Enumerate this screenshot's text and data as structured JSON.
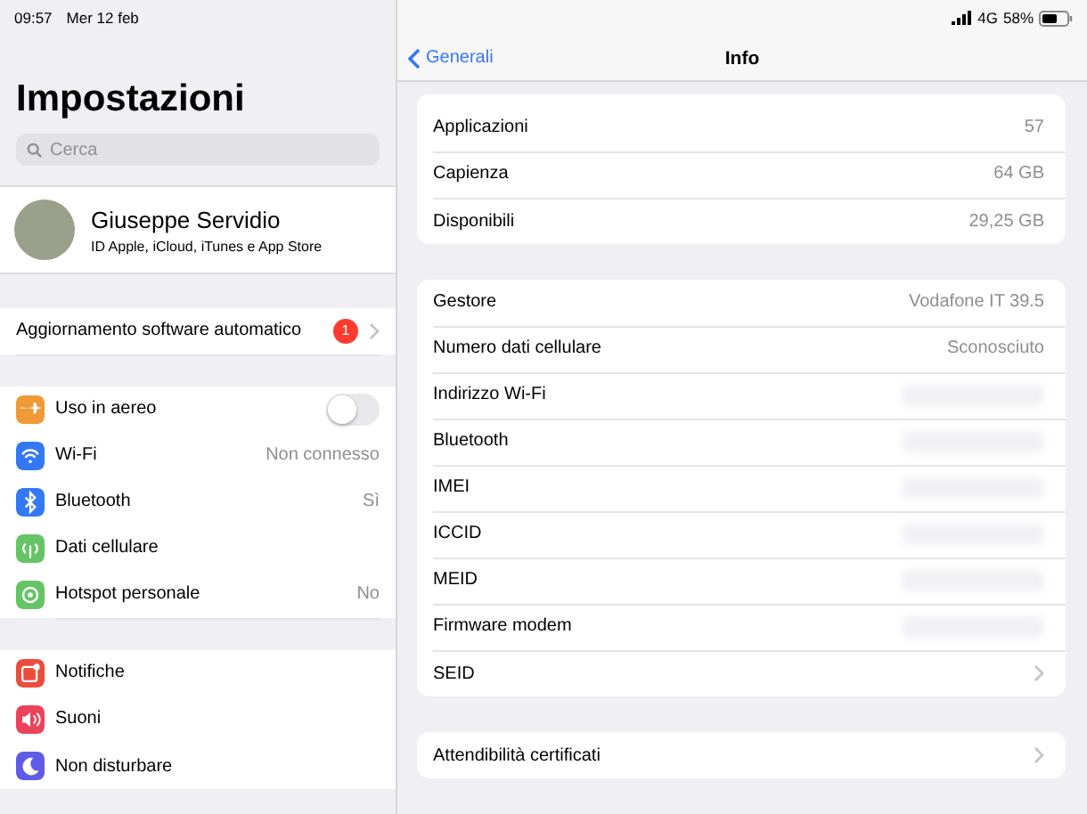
{
  "status_bar": {
    "time": "09:57",
    "date": "Mer 12 feb",
    "network": "4G",
    "battery_text": "58%"
  },
  "sidebar": {
    "title": "Impostazioni",
    "search": {
      "placeholder": "Cerca"
    },
    "profile": {
      "name": "Giuseppe Servidio",
      "subtitle": "ID Apple, iCloud, iTunes e App Store"
    },
    "update_row": {
      "label": "Aggiornamento software automatico",
      "badge": "1"
    },
    "groups": [
      [
        {
          "label": "Uso in aereo",
          "kind": "toggle",
          "on": false,
          "color": "#f09a37"
        },
        {
          "label": "Wi-Fi",
          "kind": "value",
          "value": "Non connesso",
          "color": "#3478f6"
        },
        {
          "label": "Bluetooth",
          "kind": "value",
          "value": "Sì",
          "color": "#3478f6"
        },
        {
          "label": "Dati cellulare",
          "kind": "plain",
          "color": "#65c466"
        },
        {
          "label": "Hotspot personale",
          "kind": "value",
          "value": "No",
          "color": "#65c466"
        }
      ],
      [
        {
          "label": "Notifiche",
          "kind": "plain",
          "color": "#eb4d3d"
        },
        {
          "label": "Suoni",
          "kind": "plain",
          "color": "#eb445a"
        },
        {
          "label": "Non disturbare",
          "kind": "plain",
          "color": "#5e5ce6"
        }
      ]
    ]
  },
  "detail": {
    "back": "Generali",
    "title": "Info",
    "sections": [
      [
        {
          "label": "Applicazioni",
          "kind": "value",
          "value": "57"
        },
        {
          "label": "Capienza",
          "kind": "value",
          "value": "64 GB"
        },
        {
          "label": "Disponibili",
          "kind": "value",
          "value": "29,25 GB"
        }
      ],
      [
        {
          "label": "Gestore",
          "kind": "value",
          "value": "Vodafone IT 39.5"
        },
        {
          "label": "Numero dati cellulare",
          "kind": "value",
          "value": "Sconosciuto"
        },
        {
          "label": "Indirizzo Wi-Fi",
          "kind": "hidden"
        },
        {
          "label": "Bluetooth",
          "kind": "hidden"
        },
        {
          "label": "IMEI",
          "kind": "hidden"
        },
        {
          "label": "ICCID",
          "kind": "hidden"
        },
        {
          "label": "MEID",
          "kind": "hidden"
        },
        {
          "label": "Firmware modem",
          "kind": "hidden"
        },
        {
          "label": "SEID",
          "kind": "link"
        }
      ],
      [
        {
          "label": "Attendibilità certificati",
          "kind": "link"
        }
      ]
    ]
  }
}
